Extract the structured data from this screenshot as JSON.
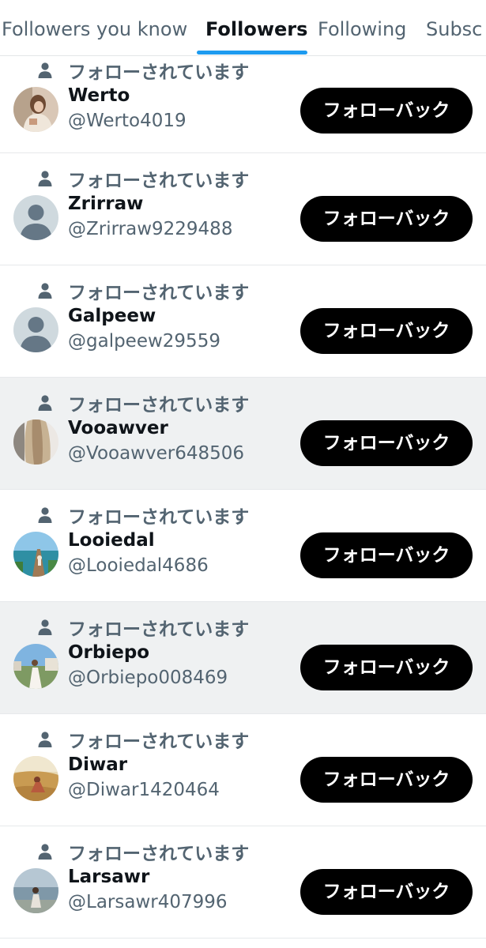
{
  "tabs": [
    {
      "label": "Followers you know"
    },
    {
      "label": "Followers",
      "active": true
    },
    {
      "label": "Following"
    },
    {
      "label": "Subsc"
    }
  ],
  "colors": {
    "accent": "#1d9bf0",
    "button_bg": "#000000",
    "secondary_text": "#536471",
    "primary_text": "#0f1419",
    "highlight_row": "#eff1f2"
  },
  "followers": [
    {
      "context": "フォローされています",
      "name": "Werto",
      "handle": "@Werto4019",
      "button": "フォローバック",
      "avatar": "photo-woman-beige",
      "highlighted": false
    },
    {
      "context": "フォローされています",
      "name": "Zrirraw",
      "handle": "@Zrirraw9229488",
      "button": "フォローバック",
      "avatar": "default-avatar",
      "highlighted": false
    },
    {
      "context": "フォローされています",
      "name": "Galpeew",
      "handle": "@galpeew29559",
      "button": "フォローバック",
      "avatar": "default-avatar",
      "highlighted": false
    },
    {
      "context": "フォローされています",
      "name": "Vooawver",
      "handle": "@Vooawver648506",
      "button": "フォローバック",
      "avatar": "photo-long-hair",
      "highlighted": true
    },
    {
      "context": "フォローされています",
      "name": "Looiedal",
      "handle": "@Looiedal4686",
      "button": "フォローバック",
      "avatar": "photo-pier-sea",
      "highlighted": false
    },
    {
      "context": "フォローされています",
      "name": "Orbiepo",
      "handle": "@Orbiepo008469",
      "button": "フォローバック",
      "avatar": "photo-white-dress",
      "highlighted": true
    },
    {
      "context": "フォローされています",
      "name": "Diwar",
      "handle": "@Diwar1420464",
      "button": "フォローバック",
      "avatar": "photo-field-sunset",
      "highlighted": false
    },
    {
      "context": "フォローされています",
      "name": "Larsawr",
      "handle": "@Larsawr407996",
      "button": "フォローバック",
      "avatar": "photo-lake-woman",
      "highlighted": false
    }
  ]
}
